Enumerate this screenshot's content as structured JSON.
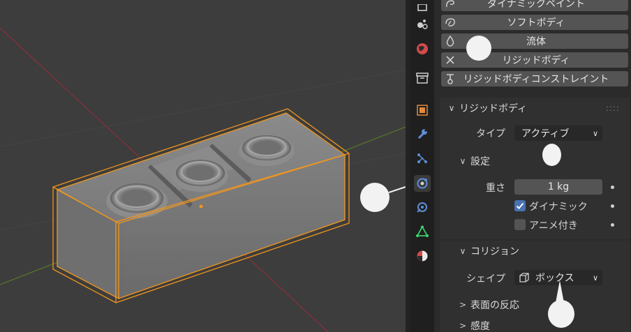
{
  "physics_buttons": [
    {
      "label": "ダイナミックペイント",
      "icon": "dynamic-paint-icon"
    },
    {
      "label": "ソフトボディ",
      "icon": "soft-body-icon"
    },
    {
      "label": "流体",
      "icon": "fluid-drop-icon"
    },
    {
      "label": "リジッドボディ",
      "icon": "close-x-icon"
    },
    {
      "label": "リジッドボディコンストレイント",
      "icon": "constraint-icon"
    }
  ],
  "rigid_body": {
    "header": "リジッドボディ",
    "type_label": "タイプ",
    "type_value": "アクティブ",
    "settings": {
      "header": "設定",
      "mass_label": "重さ",
      "mass_value": "1 kg",
      "dynamic_label": "ダイナミック",
      "dynamic_checked": true,
      "animated_label": "アニメ付き",
      "animated_checked": false
    },
    "collisions": {
      "header": "コリジョン",
      "shape_label": "シェイプ",
      "shape_value": "ボックス",
      "surface_response": "表面の反応",
      "sensitivity": "感度"
    }
  },
  "colors": {
    "viewport_bg": "#3d3d3d",
    "selection_outline": "#f0961e",
    "checkbox_checked": "#4772b3",
    "x_axis": "#8b2f3b",
    "y_axis": "#5a7a2a"
  }
}
